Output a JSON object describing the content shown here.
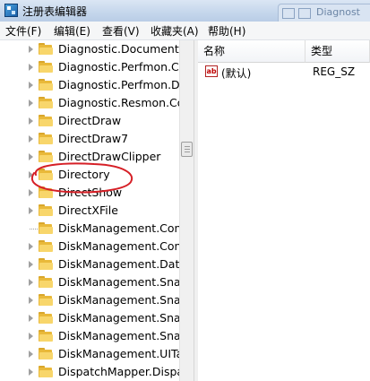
{
  "window": {
    "title": "注册表编辑器",
    "background_window_title": "Diagnost"
  },
  "menu": {
    "items": [
      "文件(F)",
      "编辑(E)",
      "查看(V)",
      "收藏夹(A)",
      "帮助(H)"
    ]
  },
  "tree": {
    "items": [
      {
        "label": "Diagnostic.Document",
        "expandable": true
      },
      {
        "label": "Diagnostic.Perfmon.Cor",
        "expandable": true
      },
      {
        "label": "Diagnostic.Perfmon.Doc",
        "expandable": true
      },
      {
        "label": "Diagnostic.Resmon.Cor",
        "expandable": true
      },
      {
        "label": "DirectDraw",
        "expandable": true
      },
      {
        "label": "DirectDraw7",
        "expandable": true
      },
      {
        "label": "DirectDrawClipper",
        "expandable": true
      },
      {
        "label": "Directory",
        "expandable": true
      },
      {
        "label": "DirectShow",
        "expandable": true
      },
      {
        "label": "DirectXFile",
        "expandable": true
      },
      {
        "label": "DiskManagement.Conn",
        "expandable": false
      },
      {
        "label": "DiskManagement.Contr",
        "expandable": true
      },
      {
        "label": "DiskManagement.Data",
        "expandable": true
      },
      {
        "label": "DiskManagement.Snap",
        "expandable": true
      },
      {
        "label": "DiskManagement.Snap",
        "expandable": true
      },
      {
        "label": "DiskManagement.Snap",
        "expandable": true
      },
      {
        "label": "DiskManagement.Snap",
        "expandable": true
      },
      {
        "label": "DiskManagement.UITas",
        "expandable": true
      },
      {
        "label": "DispatchMapper.Dispat",
        "expandable": true
      }
    ]
  },
  "list": {
    "columns": {
      "name": "名称",
      "type": "类型"
    },
    "rows": [
      {
        "icon": "string-value-icon",
        "name": "(默认)",
        "type": "REG_SZ"
      }
    ]
  },
  "annotation": {
    "color": "#d61f26",
    "target": "Directory"
  },
  "colors": {
    "folder": "#f8d66b",
    "titlebar": "#c6d7ec",
    "annotation": "#d61f26"
  }
}
